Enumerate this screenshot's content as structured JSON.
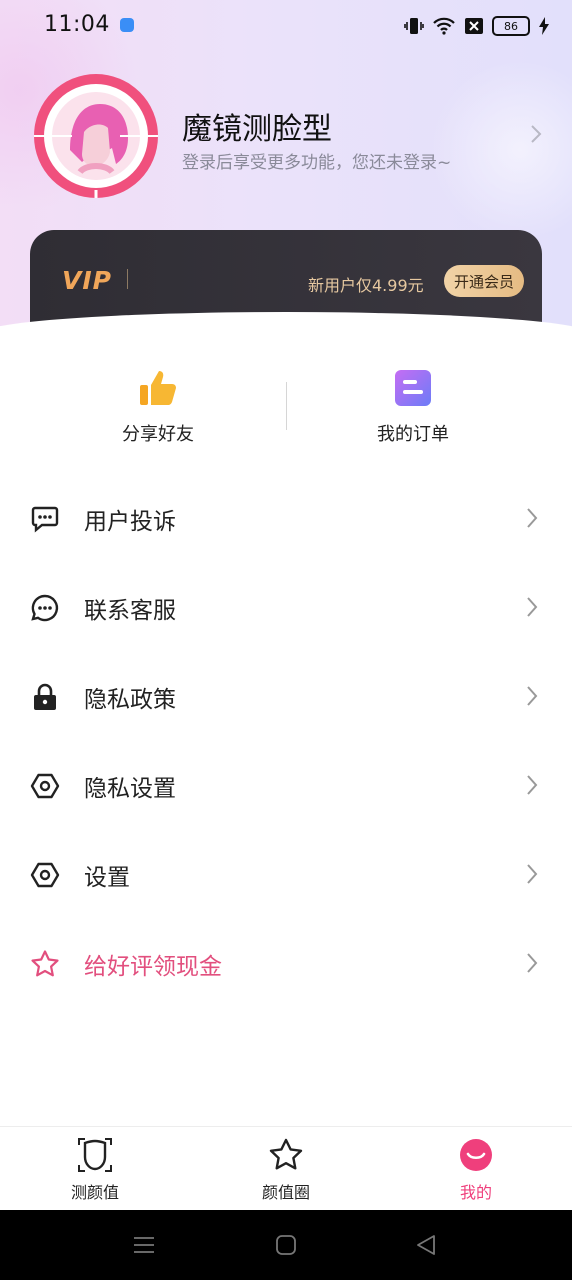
{
  "status_bar": {
    "time": "11:04",
    "battery": "86"
  },
  "profile": {
    "name": "魔镜测脸型",
    "subtitle": "登录后享受更多功能，您还未登录~"
  },
  "vip": {
    "logo": "VIP",
    "offer": "新用户仅4.99元",
    "button": "开通会员",
    "colors": {
      "card": "#2f2d34",
      "accent": "#f0a65a",
      "button": "#e9c48f"
    }
  },
  "quick_actions": [
    {
      "label": "分享好友",
      "icon": "thumbs-up-icon"
    },
    {
      "label": "我的订单",
      "icon": "order-list-icon"
    }
  ],
  "menu": [
    {
      "label": "用户投诉",
      "icon": "chat-bubble-icon"
    },
    {
      "label": "联系客服",
      "icon": "customer-service-icon"
    },
    {
      "label": "隐私政策",
      "icon": "lock-icon"
    },
    {
      "label": "隐私设置",
      "icon": "hexagon-settings-icon"
    },
    {
      "label": "设置",
      "icon": "hexagon-settings-icon"
    },
    {
      "label": "给好评领现金",
      "icon": "star-icon",
      "accent": "#e24f7e"
    }
  ],
  "tabbar": [
    {
      "label": "测颜值",
      "icon": "face-frame-icon"
    },
    {
      "label": "颜值圈",
      "icon": "star-outline-icon"
    },
    {
      "label": "我的",
      "icon": "smiley-profile-icon",
      "active": true,
      "accent": "#ef3f7c"
    }
  ]
}
